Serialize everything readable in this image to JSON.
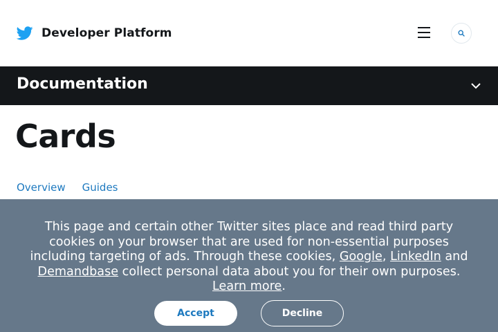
{
  "header": {
    "brand_name": "Developer Platform",
    "logo_icon": "twitter-bird-icon",
    "menu_icon": "hamburger-menu-icon",
    "search_icon": "search-icon",
    "brand_color": "#1da1f2"
  },
  "docbar": {
    "title": "Documentation",
    "toggle_icon": "chevron-down-icon"
  },
  "page": {
    "title": "Cards",
    "tabs": [
      {
        "label": "Overview"
      },
      {
        "label": "Guides"
      }
    ]
  },
  "cookie_banner": {
    "text_1": "This page and certain other Twitter sites place and read third party cookies on your browser that are used for non-essential purposes including targeting of ads. Through these cookies, ",
    "link_google": "Google",
    "sep_1": ", ",
    "link_linkedin": "LinkedIn",
    "sep_2": " and ",
    "link_demandbase": "Demandbase",
    "text_2": " collect personal data about you for their own purposes. ",
    "link_learn_more": "Learn more",
    "text_end": ".",
    "accept_label": "Accept",
    "decline_label": "Decline",
    "background_color": "#66788a",
    "link_color": "#1d79bf"
  }
}
